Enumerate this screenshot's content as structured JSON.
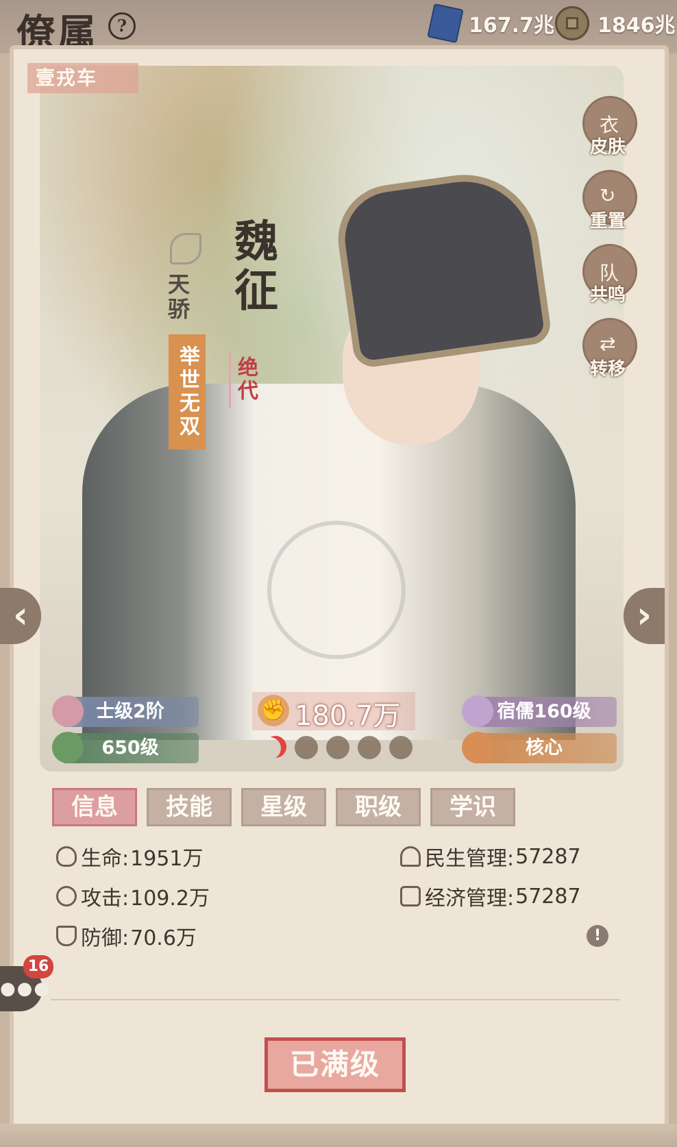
{
  "header": {
    "title": "僚属",
    "resources": [
      {
        "icon": "book-icon",
        "value": "167.7兆"
      },
      {
        "icon": "coin-icon",
        "value": "1846兆"
      }
    ]
  },
  "character": {
    "tag": "壹戎车",
    "name": "魏征",
    "title": "天骄",
    "badge_main": "举世无双",
    "badge_rarity": "绝代",
    "power": "180.7万",
    "rank": "士级2阶",
    "level": "650级",
    "mentor": "宿儒160级",
    "role": "核心"
  },
  "side_actions": [
    "皮肤",
    "重置",
    "共鸣",
    "转移"
  ],
  "tabs": [
    "信息",
    "技能",
    "星级",
    "职级",
    "学识"
  ],
  "attributes_left": [
    {
      "label": "生命:",
      "value": "1951万",
      "icon": "heart-icon"
    },
    {
      "label": "攻击:",
      "value": "109.2万",
      "icon": "attack-icon"
    },
    {
      "label": "防御:",
      "value": "70.6万",
      "icon": "shield-icon"
    }
  ],
  "attributes_right": [
    {
      "label": "民生管理:",
      "value": "57287",
      "icon": "people-icon"
    },
    {
      "label": "经济管理:",
      "value": "57287",
      "icon": "abacus-icon"
    }
  ],
  "chat": {
    "badge": "16"
  },
  "footer": {
    "max_label": "已满级"
  },
  "colors": {
    "accent": "#dd9ea1",
    "stamp": "#c2504b",
    "gold": "#d8914f"
  }
}
